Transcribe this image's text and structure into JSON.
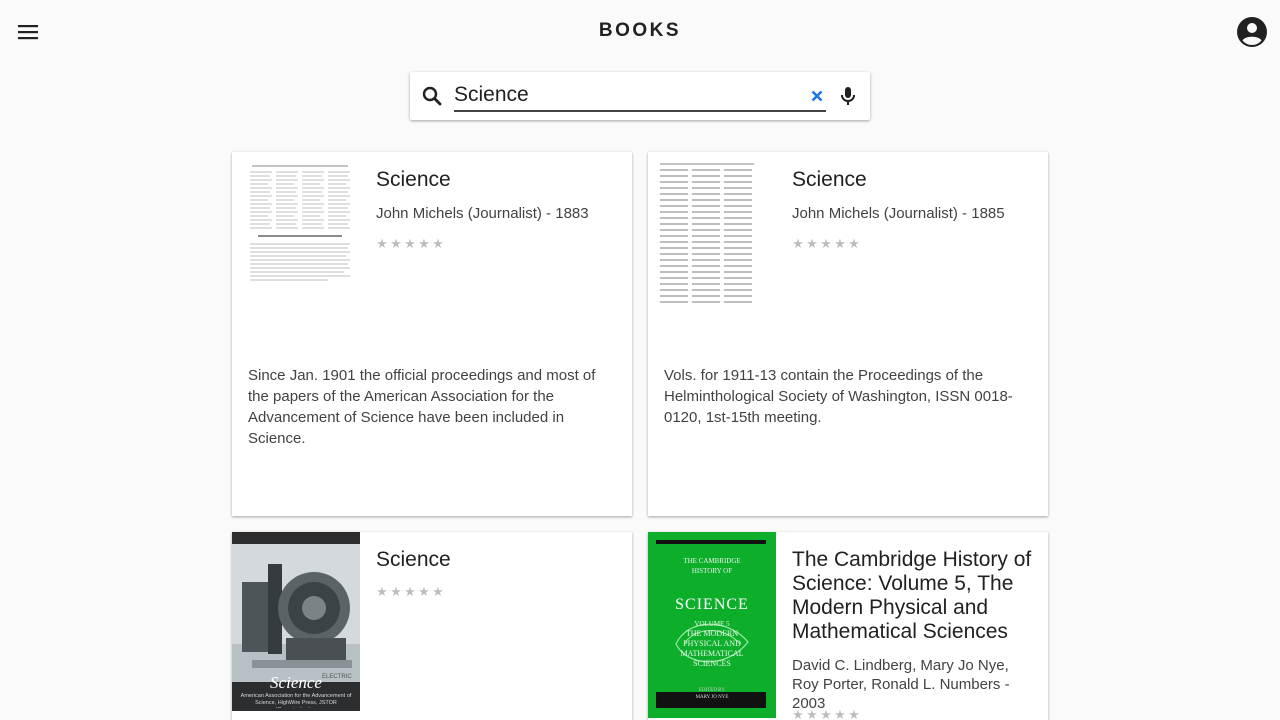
{
  "app": {
    "title": "BOOKS",
    "menu_icon": "menu-icon",
    "account_icon": "account-circle-icon"
  },
  "search": {
    "value": "Science",
    "search_icon": "search-icon",
    "clear_icon": "close-icon",
    "mic_icon": "mic-icon",
    "accent_color": "#1a73e8"
  },
  "results": [
    {
      "title": "Science",
      "author": "John Michels (Journalist) - 1883",
      "rating": 0,
      "description": "Since Jan. 1901 the official proceedings and most of the papers of the American Association for the Advancement of Science have been included in Science."
    },
    {
      "title": "Science",
      "author": "John Michels (Journalist) - 1885",
      "rating": 0,
      "description": "Vols. for 1911-13 contain the Proceedings of the Helminthological Society of Washington, ISSN 0018-0120, 1st-15th meeting."
    },
    {
      "title": "Science",
      "rating": 0,
      "cover_title": "Science",
      "cover_subtitle": "American Association for the Advancement of Science, HighWire Press, JSTOR (Organization)...."
    },
    {
      "title": "The Cambridge History of Science: Volume 5, The Modern Physical and Mathematical Sciences",
      "author": "David C. Lindberg, Mary Jo Nye, Roy Porter, Ronald L. Numbers - 2003",
      "rating": 0,
      "cover_header": "THE CAMBRIDGE HISTORY OF",
      "cover_title": "SCIENCE",
      "cover_volume": "VOLUME 5",
      "cover_subtitle": "THE MODERN PHYSICAL AND MATHEMATICAL SCIENCES",
      "cover_edited": "EDITED BY",
      "cover_editor": "MARY JO NYE",
      "cover_color": "#0cae2a"
    }
  ]
}
